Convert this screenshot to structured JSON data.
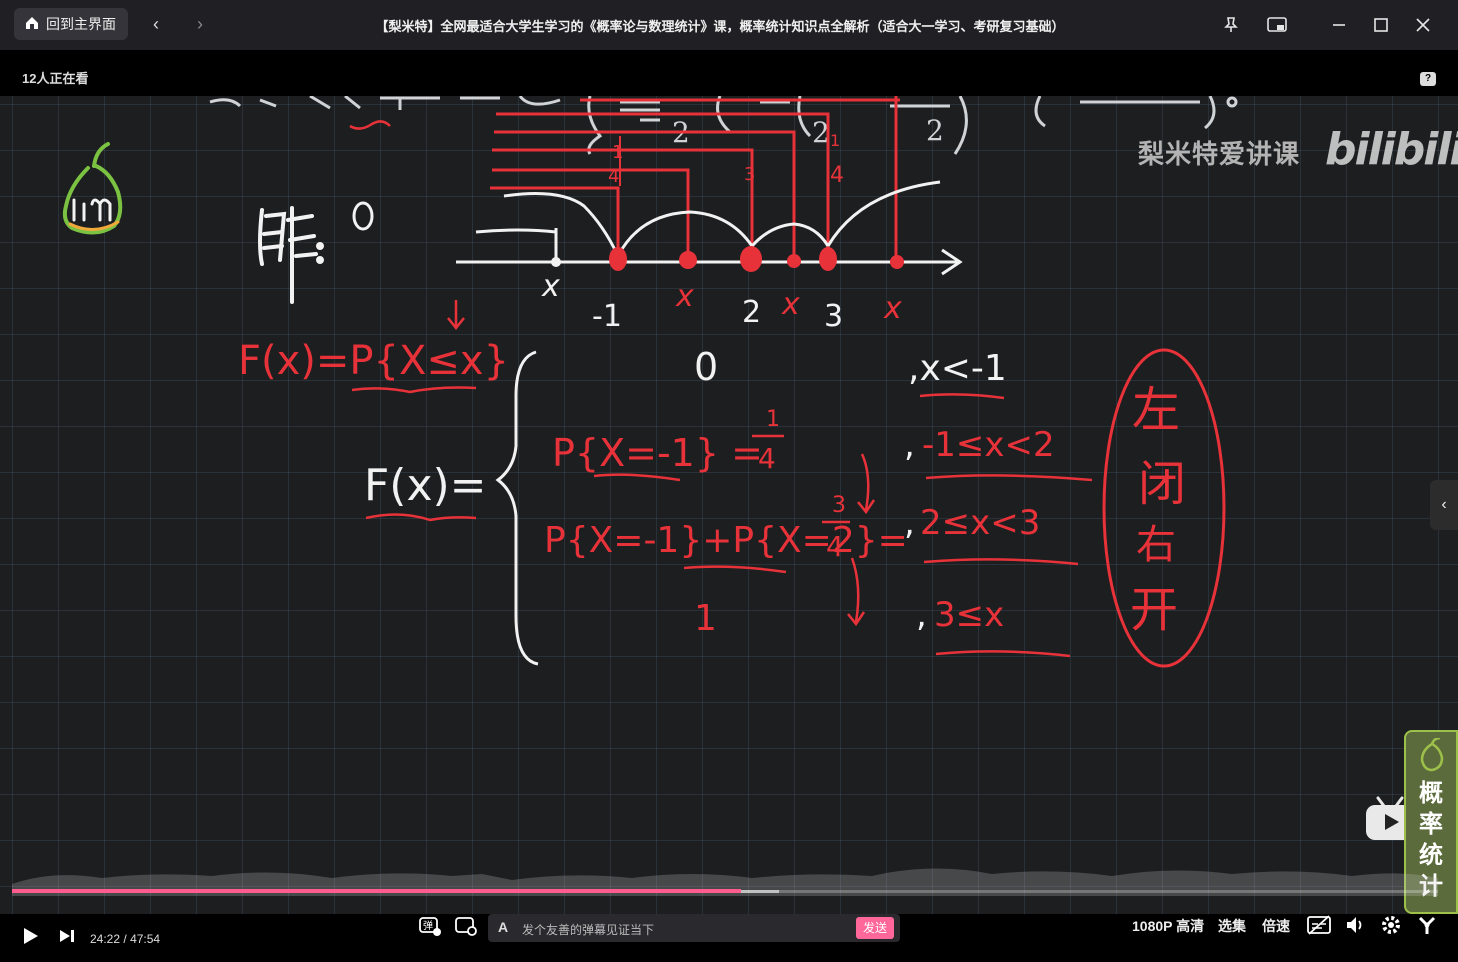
{
  "titlebar": {
    "home_label": "回到主界面",
    "back_icon": "chevron-left-icon",
    "forward_icon": "chevron-right-icon",
    "title": "【梨米特】全网最适合大学生学习的《概率论与数理统计》课，概率统计知识点全解析（适合大一学习、考研复习基础）",
    "pin_icon": "pin-icon",
    "pip_icon": "picture-in-picture-icon",
    "minimize_icon": "minimize-icon",
    "maximize_icon": "maximize-icon",
    "close_icon": "close-icon"
  },
  "viewers": {
    "count_text": "12人正在看"
  },
  "video": {
    "watermark": "梨米特爱讲课",
    "bili_logo": "bilibili",
    "promo_text": "概率统计"
  },
  "controls": {
    "current_time": "24:22",
    "separator": "/",
    "total_time": "47:54",
    "progress_fraction": 0.511,
    "buffer_fraction": 0.538,
    "danmaku_placeholder": "发个友善的弹幕见证当下",
    "send_label": "发送",
    "quality_label": "1080P 高清",
    "episodes_label": "选集",
    "speed_label": "倍速"
  },
  "colors": {
    "accent": "#ff6699",
    "chalk_red": "#e8323a",
    "chalk_white": "#f2f2f2",
    "board": "#1c1e1f"
  }
}
